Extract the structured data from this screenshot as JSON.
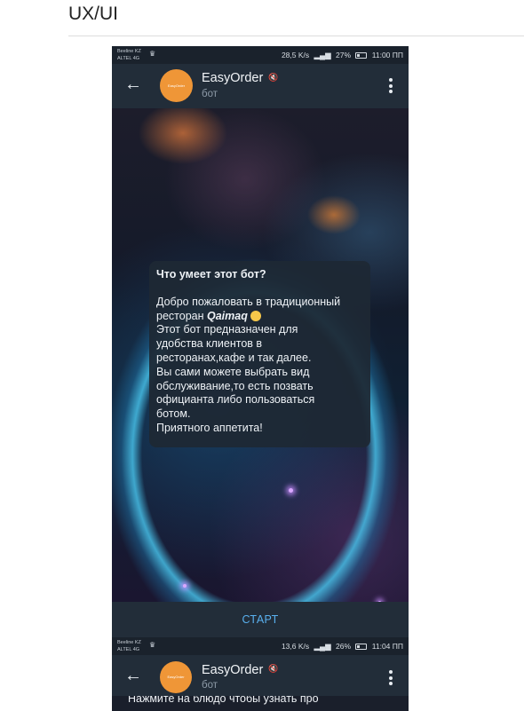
{
  "page": {
    "title": "UX/UI"
  },
  "screens": [
    {
      "status": {
        "carrier1": "Beeline KZ",
        "carrier2": "ALTEL 4G",
        "speed": "28,5 K/s",
        "net": "4G",
        "battery": "27%",
        "time": "11:00 ПП"
      },
      "header": {
        "name": "EasyOrder",
        "subtitle": "бот",
        "avatar_text": "EasyOrder"
      },
      "card": {
        "title": "Что умеет этот бот?",
        "line1": "Добро пожаловать в традиционный",
        "line2_prefix": "ресторан ",
        "line2_brand": "Qaimaq",
        "lines": [
          "Этот бот предназначен для",
          "удобства клиентов в",
          "ресторанах,кафе и так далее.",
          "Вы сами можете выбрать вид",
          "обслуживание,то есть позвать",
          "официанта либо пользоваться",
          "ботом.",
          "Приятного аппетита!"
        ]
      },
      "start_button": "СТАРТ"
    },
    {
      "status": {
        "carrier1": "Beeline KZ",
        "carrier2": "ALTEL 4G",
        "speed": "13,6 K/s",
        "net": "4G",
        "battery": "26%",
        "time": "11:04 ПП"
      },
      "header": {
        "name": "EasyOrder",
        "subtitle": "бот",
        "avatar_text": "EasyOrder"
      },
      "peek_text": "Нажмите на блюдо чтобы узнать про"
    }
  ],
  "icons": {
    "back": "arrow-left",
    "menu": "three-dots-vertical",
    "mute": "muted-speaker",
    "signal": "signal-bars",
    "battery": "battery",
    "crown": "crown",
    "smile": "smiling-face"
  },
  "colors": {
    "header_bg": "#222d39",
    "status_bg": "#1a222c",
    "avatar": "#ef9637",
    "link": "#59b0ee",
    "card_bg": "#1e2834"
  }
}
